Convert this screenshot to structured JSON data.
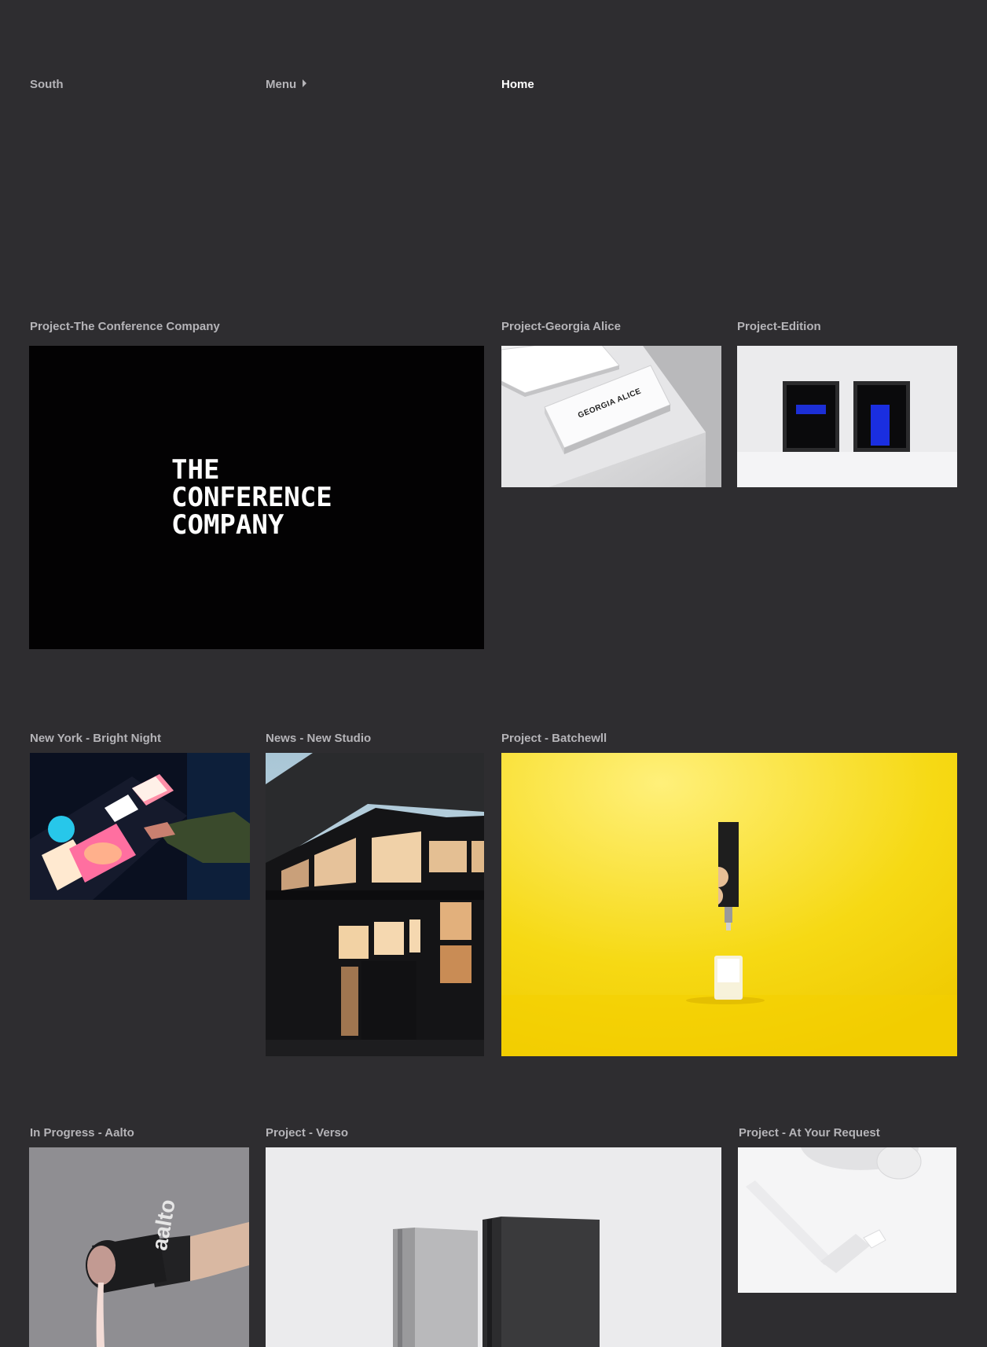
{
  "header": {
    "brand": "South",
    "menu_label": "Menu",
    "home_label": "Home"
  },
  "projects": {
    "conference": {
      "label": "Project-The Conference Company",
      "logo_lines": [
        "THE",
        "CONFERENCE",
        "COMPANY"
      ]
    },
    "georgia": {
      "label": "Project-Georgia Alice",
      "card_text": "GEORGIA ALICE"
    },
    "edition": {
      "label": "Project-Edition"
    },
    "newyork": {
      "label": "New York - Bright Night"
    },
    "studio": {
      "label": "News - New Studio"
    },
    "batchewll": {
      "label": "Project - Batchewll"
    },
    "aalto": {
      "label": "In Progress - Aalto",
      "can_text": "aalto"
    },
    "verso": {
      "label": "Project - Verso"
    },
    "request": {
      "label": "Project - At Your Request"
    }
  },
  "colors": {
    "background": "#2e2d30",
    "label": "#b5b4b8",
    "active": "#ffffff",
    "batchewll_yellow": "#f6d914"
  },
  "icons": {
    "menu": "caret-right-icon"
  }
}
